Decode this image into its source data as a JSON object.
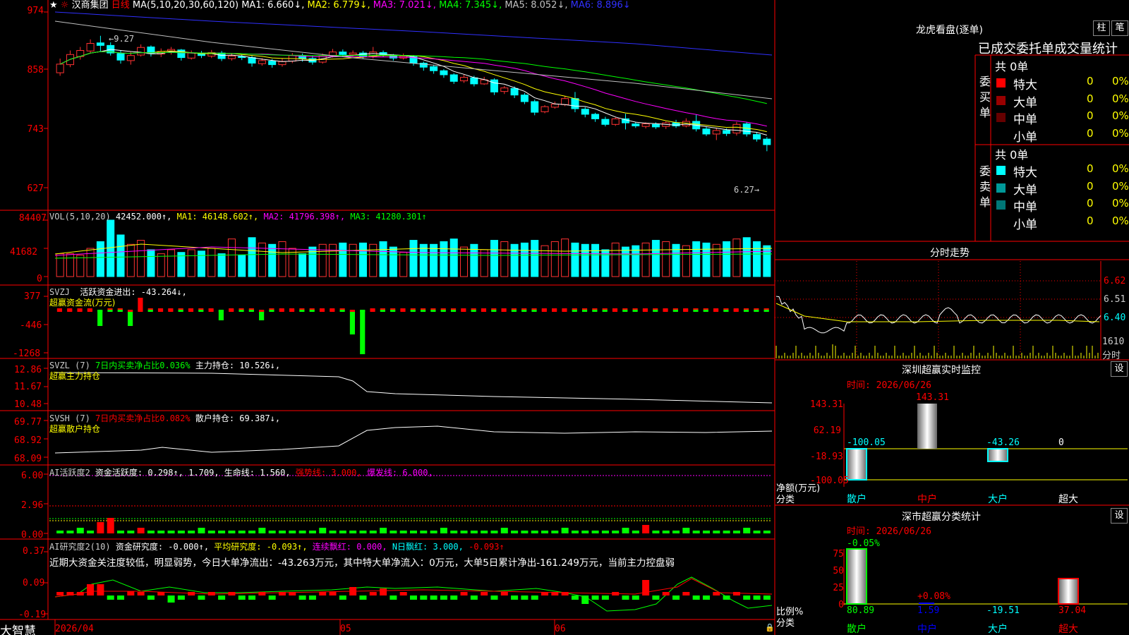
{
  "stock": {
    "name": "汉商集团",
    "period": "日线",
    "star": "★"
  },
  "ma_row": {
    "label": "MA(5,10,20,30,60,120)",
    "items": [
      {
        "text": "MA1: 6.660↓,",
        "color": "#ffffff"
      },
      {
        "text": "MA2: 6.779↓,",
        "color": "#ffff00"
      },
      {
        "text": "MA3: 7.021↓,",
        "color": "#ff00ff"
      },
      {
        "text": "MA4: 7.345↓,",
        "color": "#00ff00"
      },
      {
        "text": "MA5: 8.052↓,",
        "color": "#c0c0c0"
      },
      {
        "text": "MA6: 8.896↓",
        "color": "#3030ff"
      }
    ]
  },
  "main_axis": {
    "ticks": [
      "974",
      "858",
      "743",
      "627"
    ],
    "max": 9.74,
    "min": 6.27
  },
  "annotations": {
    "high": "9.27",
    "low": "6.27"
  },
  "vol": {
    "label": "VOL(5,10,20)",
    "value": "42452.000↑,",
    "ma1": "MA1: 46148.602↑,",
    "ma2": "MA2: 41796.398↑,",
    "ma3": "MA3: 41280.301↑",
    "ticks": [
      "84407",
      "41682",
      "0"
    ]
  },
  "svzj": {
    "label": "SVZJ",
    "desc": "活跃资金进出: -43.264↓,",
    "sub": "超赢资金流(万元)",
    "ticks": [
      "377",
      "-446",
      "-1268"
    ]
  },
  "svzl": {
    "label": "SVZL (7)",
    "desc_green": "7日内买卖净占比0.036%",
    "desc_white": "主力持仓: 10.526↓,",
    "sub": "超赢主力持仓",
    "ticks": [
      "12.86",
      "11.67",
      "10.48"
    ]
  },
  "svsh": {
    "label": "SVSH (7)",
    "desc_red": "7日内买卖净占比0.082%",
    "desc_white": "散户持仓: 69.387↓,",
    "sub": "超赢散户持仓",
    "ticks": [
      "69.77",
      "68.92",
      "68.09"
    ]
  },
  "ai_active": {
    "label": "AI活跃度2",
    "desc1": "资金活跃度: 0.298↑,",
    "desc1b": "1.709,",
    "desc2": "生命线: 1.560,",
    "desc3": "强势线: 3.000,",
    "desc4": "爆发线: 6.000,",
    "ticks": [
      "6.00",
      "2.96",
      "0.00"
    ]
  },
  "ai_research": {
    "label": "AI研究度2(10)",
    "desc1": "资金研究度: -0.000↑,",
    "desc2": "平均研究度: -0.093↑,",
    "desc3": "连续飘红: 0.000,",
    "desc4": "N日飘红: 3.000,",
    "desc5": "-0.093↑",
    "comment": "近期大资金关注度较低，明显弱势，今日大单净流出：-43.263万元，其中特大单净流入：0万元，大单5日累计净出-161.249万元，当前主力控盘弱",
    "ticks": [
      "0.37",
      "0.09",
      "-0.19"
    ]
  },
  "xaxis": {
    "start": "2026/04",
    "m1": "05",
    "m2": "06"
  },
  "app": {
    "name": "大智慧"
  },
  "dragon": {
    "title": "龙虎看盘(逐单)",
    "btn1": "柱",
    "btn2": "笔",
    "subtitle": "已成交委托单成交量统计",
    "buy_label": "委买单",
    "sell_label": "委卖单",
    "buy_total": "共 0单",
    "sell_total": "共 0单",
    "buy_rows": [
      {
        "label": "特大",
        "count": "0",
        "pct": "0%",
        "color": "#ff0000"
      },
      {
        "label": "大单",
        "count": "0",
        "pct": "0%",
        "color": "#990000"
      },
      {
        "label": "中单",
        "count": "0",
        "pct": "0%",
        "color": "#660000"
      },
      {
        "label": "小单",
        "count": "0",
        "pct": "0%",
        "color": "#000000"
      }
    ],
    "sell_rows": [
      {
        "label": "特大",
        "count": "0",
        "pct": "0%",
        "color": "#00ffff"
      },
      {
        "label": "大单",
        "count": "0",
        "pct": "0%",
        "color": "#009999"
      },
      {
        "label": "中单",
        "count": "0",
        "pct": "0%",
        "color": "#007777"
      },
      {
        "label": "小单",
        "count": "0",
        "pct": "0%",
        "color": "#000000"
      }
    ]
  },
  "intraday": {
    "title": "分时走势",
    "ticks": [
      "6.62",
      "6.51",
      "6.40"
    ],
    "vol_tick": "1610",
    "vol_label": "分时"
  },
  "monitor": {
    "title": "深圳超赢实时监控",
    "btn": "设",
    "time": "时间: 2026/06/26",
    "ticks": [
      "143.31",
      "62.19",
      "-18.93",
      "-100.05"
    ],
    "bar_labels": [
      "-100.05",
      "143.31",
      "-43.26",
      "0"
    ],
    "axis_label1": "净额(万元)",
    "axis_label2": "分类",
    "cats": [
      "散户",
      "中户",
      "大户",
      "超大"
    ]
  },
  "category": {
    "title": "深市超赢分类统计",
    "btn": "设",
    "time": "时间: 2026/06/26",
    "ticks": [
      "75",
      "50",
      "25",
      "0"
    ],
    "top_labels": [
      "-0.05%",
      "+0.08%"
    ],
    "values": [
      "80.89",
      "1.59",
      "-19.51",
      "37.04"
    ],
    "axis_label1": "比例%",
    "axis_label2": "分类",
    "cats": [
      "散户",
      "中户",
      "大户",
      "超大"
    ]
  },
  "chart_data": {
    "type": "candlestick",
    "candles": [
      [
        8.54,
        8.71,
        8.48,
        8.82
      ],
      [
        8.7,
        8.9,
        8.65,
        8.98
      ],
      [
        8.86,
        8.98,
        8.8,
        9.05
      ],
      [
        8.97,
        9.12,
        8.92,
        9.2
      ],
      [
        9.13,
        9.08,
        8.95,
        9.27
      ],
      [
        9.08,
        8.93,
        8.88,
        9.14
      ],
      [
        8.92,
        8.79,
        8.72,
        8.98
      ],
      [
        8.78,
        8.88,
        8.7,
        8.95
      ],
      [
        8.89,
        9.04,
        8.86,
        9.1
      ],
      [
        9.05,
        8.92,
        8.86,
        9.08
      ],
      [
        8.91,
        8.96,
        8.85,
        9.02
      ],
      [
        8.97,
        9.0,
        8.9,
        9.05
      ],
      [
        8.99,
        8.84,
        8.78,
        9.01
      ],
      [
        8.83,
        8.93,
        8.8,
        8.98
      ],
      [
        8.93,
        8.88,
        8.83,
        8.97
      ],
      [
        8.87,
        8.94,
        8.83,
        8.99
      ],
      [
        8.93,
        8.82,
        8.77,
        8.97
      ],
      [
        8.82,
        8.87,
        8.78,
        8.92
      ],
      [
        8.86,
        8.84,
        8.79,
        8.9
      ],
      [
        8.84,
        8.73,
        8.66,
        8.88
      ],
      [
        8.72,
        8.78,
        8.68,
        8.83
      ],
      [
        8.77,
        8.7,
        8.64,
        8.81
      ],
      [
        8.7,
        8.76,
        8.66,
        8.82
      ],
      [
        8.77,
        8.88,
        8.73,
        8.93
      ],
      [
        8.88,
        8.82,
        8.76,
        8.92
      ],
      [
        8.82,
        8.75,
        8.7,
        8.88
      ],
      [
        8.75,
        8.88,
        8.72,
        8.92
      ],
      [
        8.88,
        8.95,
        8.84,
        9.01
      ],
      [
        8.95,
        8.9,
        8.85,
        9.0
      ],
      [
        8.9,
        8.93,
        8.86,
        8.98
      ],
      [
        8.93,
        8.87,
        8.82,
        8.97
      ],
      [
        8.86,
        8.95,
        8.82,
        9.05
      ],
      [
        8.94,
        8.89,
        8.85,
        8.98
      ],
      [
        8.88,
        8.83,
        8.78,
        8.91
      ],
      [
        8.83,
        8.87,
        8.8,
        8.92
      ],
      [
        8.86,
        8.73,
        8.68,
        8.89
      ],
      [
        8.73,
        8.65,
        8.58,
        8.76
      ],
      [
        8.66,
        8.58,
        8.52,
        8.7
      ],
      [
        8.58,
        8.5,
        8.44,
        8.61
      ],
      [
        8.5,
        8.37,
        8.32,
        8.53
      ],
      [
        8.38,
        8.45,
        8.34,
        8.5
      ],
      [
        8.44,
        8.32,
        8.27,
        8.48
      ],
      [
        8.32,
        8.4,
        8.3,
        8.46
      ],
      [
        8.4,
        8.16,
        8.1,
        8.43
      ],
      [
        8.17,
        8.24,
        8.12,
        8.28
      ],
      [
        8.23,
        8.1,
        8.04,
        8.27
      ],
      [
        8.1,
        7.97,
        7.92,
        8.14
      ],
      [
        7.97,
        7.76,
        7.7,
        8.01
      ],
      [
        7.77,
        7.87,
        7.74,
        7.9
      ],
      [
        7.86,
        7.92,
        7.83,
        7.97
      ],
      [
        7.91,
        8.03,
        7.88,
        8.08
      ],
      [
        8.03,
        7.83,
        7.76,
        8.16
      ],
      [
        7.82,
        7.72,
        7.66,
        7.86
      ],
      [
        7.72,
        7.63,
        7.57,
        7.75
      ],
      [
        7.62,
        7.52,
        7.48,
        7.67
      ],
      [
        7.52,
        7.63,
        7.49,
        7.66
      ],
      [
        7.63,
        7.55,
        7.42,
        7.73
      ],
      [
        7.53,
        7.49,
        7.45,
        7.57
      ],
      [
        7.48,
        7.53,
        7.44,
        7.56
      ],
      [
        7.52,
        7.47,
        7.43,
        7.56
      ],
      [
        7.48,
        7.55,
        7.43,
        7.58
      ],
      [
        7.55,
        7.49,
        7.45,
        7.61
      ],
      [
        7.49,
        7.58,
        7.46,
        7.64
      ],
      [
        7.58,
        7.43,
        7.38,
        7.72
      ],
      [
        7.43,
        7.33,
        7.29,
        7.47
      ],
      [
        7.33,
        7.4,
        7.21,
        7.45
      ],
      [
        7.4,
        7.34,
        7.29,
        7.44
      ],
      [
        7.35,
        7.52,
        7.3,
        7.57
      ],
      [
        7.53,
        7.33,
        7.28,
        7.57
      ],
      [
        7.32,
        7.23,
        7.18,
        7.36
      ],
      [
        7.23,
        7.12,
        6.99,
        7.27
      ]
    ],
    "volumes": [
      34,
      34,
      32,
      42,
      52,
      84,
      62,
      48,
      54,
      40,
      34,
      40,
      36,
      40,
      38,
      42,
      34,
      56,
      32,
      58,
      50,
      48,
      52,
      42,
      34,
      44,
      48,
      48,
      50,
      48,
      50,
      48,
      52,
      44,
      36,
      54,
      48,
      48,
      52,
      56,
      44,
      48,
      40,
      54,
      52,
      48,
      50,
      54,
      46,
      52,
      56,
      50,
      48,
      48,
      40,
      50,
      44,
      46,
      50,
      54,
      52,
      48,
      46,
      52,
      50,
      48,
      52,
      56,
      58,
      52,
      46
    ]
  }
}
